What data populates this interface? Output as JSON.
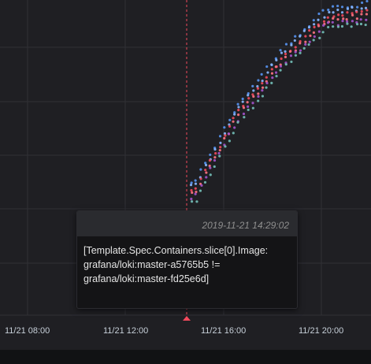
{
  "graph": {
    "x_ticks": [
      "11/21 08:00",
      "11/21 12:00",
      "11/21 16:00",
      "11/21 20:00"
    ],
    "annotation_color": "#f2495c",
    "series_colors": [
      "#5794f2",
      "#8ab8ff",
      "#f2495c",
      "#ff7383",
      "#a352cc",
      "#73bfb8"
    ]
  },
  "annotation": {
    "time": "2019-11-21 14:29:02",
    "text_lines": [
      "[Template.Spec.Containers.slice[0].Image:",
      "grafana/loki:master-a5765b5 !=",
      "grafana/loki:master-fd25e6d]"
    ]
  }
}
